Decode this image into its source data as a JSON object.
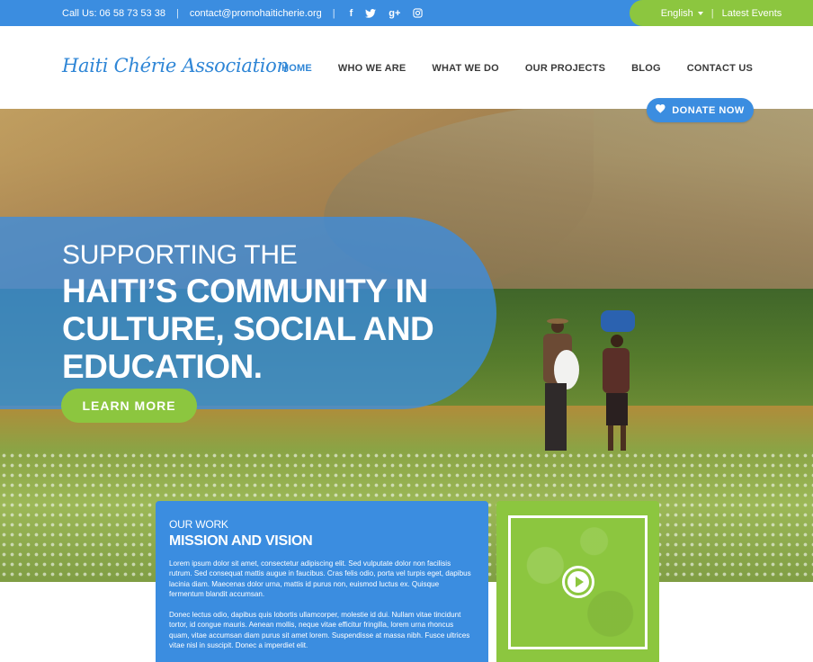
{
  "topbar": {
    "phone": "Call Us: 06 58 73 53 38",
    "email": "contact@promohaiticherie.org",
    "separator": "|",
    "social": [
      {
        "icon": "facebook-icon",
        "glyph": "f"
      },
      {
        "icon": "twitter-icon",
        "glyph": "t"
      },
      {
        "icon": "google-plus-icon",
        "glyph": "g+"
      },
      {
        "icon": "instagram-icon",
        "glyph": "◎"
      }
    ],
    "language": "English",
    "latest_events": "Latest Events"
  },
  "header": {
    "logo": "Haiti Chérie Association",
    "nav": [
      {
        "label": "HOME",
        "active": true
      },
      {
        "label": "WHO WE ARE",
        "active": false
      },
      {
        "label": "WHAT WE DO",
        "active": false
      },
      {
        "label": "OUR PROJECTS",
        "active": false
      },
      {
        "label": "BLOG",
        "active": false
      },
      {
        "label": "CONTACT US",
        "active": false
      }
    ],
    "donate": "DONATE NOW"
  },
  "hero": {
    "line1": "SUPPORTING THE",
    "line2": "HAITI’S COMMUNITY IN",
    "line3": "CULTURE, SOCIAL AND",
    "line4": "EDUCATION.",
    "cta": "LEARN MORE"
  },
  "mission": {
    "eyebrow": "OUR WORK",
    "title": "MISSION AND VISION",
    "para1": "Lorem ipsum dolor sit amet, consectetur adipiscing elit. Sed vulputate dolor non facilisis rutrum. Sed consequat mattis augue in faucibus. Cras felis odio, porta vel turpis eget, dapibus lacinia diam. Maecenas dolor urna, mattis id purus non, euismod luctus ex. Quisque fermentum blandit accumsan.",
    "para2": "Donec lectus odio, dapibus quis lobortis ullamcorper, molestie id dui. Nullam vitae tincidunt tortor, id congue mauris. Aenean mollis, neque vitae efficitur fringilla, lorem urna rhoncus quam, vitae accumsan diam purus sit amet lorem. Suspendisse at massa nibh. Fusce ultrices vitae nisl in suscipit. Donec a imperdiet elit."
  },
  "video": {
    "icon": "play-icon"
  },
  "colors": {
    "primary_blue": "#3b8de0",
    "accent_green": "#8cc63f",
    "nav_active": "#2f86d6"
  }
}
